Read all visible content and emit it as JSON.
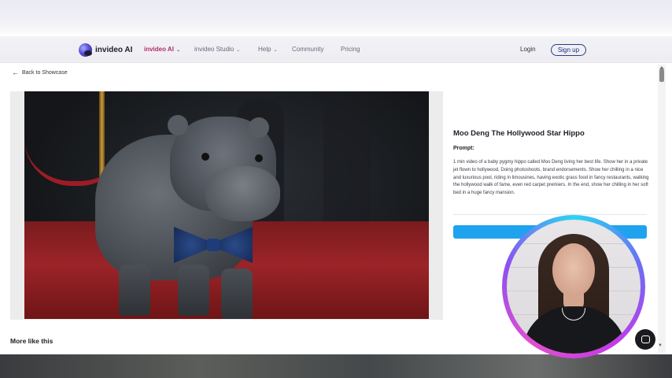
{
  "nav": {
    "brand": "invideo AI",
    "links": [
      {
        "label": "invideo AI",
        "active": true,
        "has_caret": true
      },
      {
        "label": "invideo Studio",
        "active": false,
        "has_caret": true
      },
      {
        "label": "Help",
        "active": false,
        "has_caret": true
      },
      {
        "label": "Community",
        "active": false,
        "has_caret": false
      },
      {
        "label": "Pricing",
        "active": false,
        "has_caret": false
      }
    ],
    "login": "Login",
    "signup": "Sign up"
  },
  "back": {
    "label": "Back to Showcase",
    "icon": "arrow-left-icon"
  },
  "showcase": {
    "title": "Moo Deng The Hollywood Star Hippo",
    "prompt_label": "Prompt:",
    "prompt_text": "1 min video of a baby pygmy hippo called Moo Deng living her best life. Show her in a private jet flown to hollywood, Doing photoshoots, brand endorsements. Show her chilling in a nice and luxurious pool, riding in limousines, having exotic grass food in fancy restaurants, walking the hollywood walk of fame, even red carpet premiers. In the end, show her chilling in her soft bed in a huge fancy mansion."
  },
  "more": {
    "label": "More like this"
  },
  "colors": {
    "accent": "#b0306a",
    "cta": "#1fa3ee",
    "signup_border": "#2a3c88"
  }
}
